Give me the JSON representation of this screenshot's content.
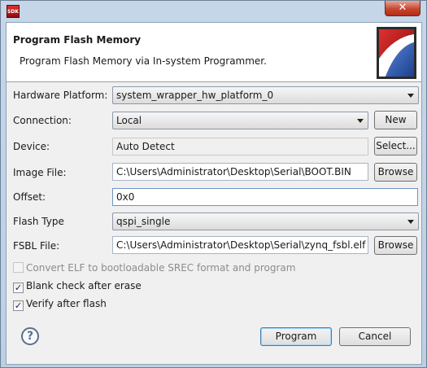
{
  "window": {
    "app_icon_text": "SDK",
    "close_glyph": "✕"
  },
  "header": {
    "title": "Program Flash Memory",
    "description": "Program Flash Memory via In-system Programmer."
  },
  "form": {
    "hardware_platform": {
      "label": "Hardware Platform:",
      "value": "system_wrapper_hw_platform_0"
    },
    "connection": {
      "label": "Connection:",
      "value": "Local",
      "new_button": "New"
    },
    "device": {
      "label": "Device:",
      "value": "Auto Detect",
      "select_button": "Select..."
    },
    "image_file": {
      "label": "Image File:",
      "value": "C:\\Users\\Administrator\\Desktop\\Serial\\BOOT.BIN",
      "browse_button": "Browse"
    },
    "offset": {
      "label": "Offset:",
      "value": "0x0"
    },
    "flash_type": {
      "label": "Flash Type",
      "value": "qspi_single"
    },
    "fsbl_file": {
      "label": "FSBL File:",
      "value": "C:\\Users\\Administrator\\Desktop\\Serial\\zynq_fsbl.elf",
      "browse_button": "Browse"
    }
  },
  "options": {
    "convert_elf": {
      "label": "Convert ELF to bootloadable SREC format and program",
      "checked": false,
      "enabled": false
    },
    "blank_check": {
      "label": "Blank check after erase",
      "checked": true,
      "mark": "✓"
    },
    "verify": {
      "label": "Verify after flash",
      "checked": true,
      "mark": "✓"
    }
  },
  "footer": {
    "help_glyph": "?",
    "program_button": "Program",
    "cancel_button": "Cancel"
  },
  "icons": {
    "help": "help-icon",
    "close": "close-icon",
    "dropdown": "chevron-down-icon",
    "app": "sdk-app-icon",
    "banner": "sdk-banner-logo"
  }
}
